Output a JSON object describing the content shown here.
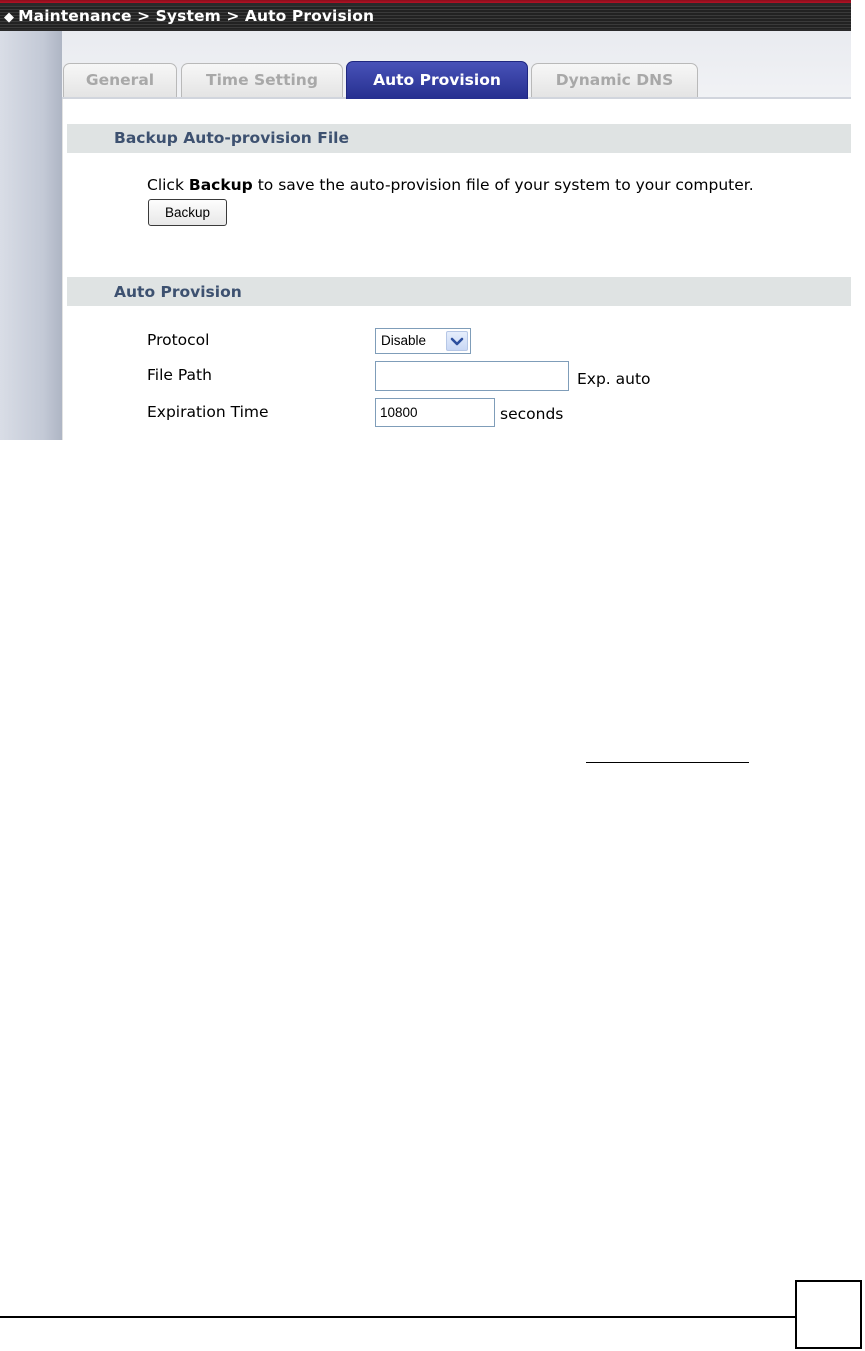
{
  "breadcrumb": "Maintenance > System > Auto Provision",
  "tabs": [
    {
      "label": "General",
      "active": false
    },
    {
      "label": "Time Setting",
      "active": false
    },
    {
      "label": "Auto Provision",
      "active": true
    },
    {
      "label": "Dynamic DNS",
      "active": false
    }
  ],
  "backup_section": {
    "title": "Backup Auto-provision File",
    "instruction_prefix": "Click ",
    "instruction_bold": "Backup",
    "instruction_suffix": " to save the auto-provision file of your system to your computer.",
    "button_label": "Backup"
  },
  "auto_provision_section": {
    "title": "Auto Provision",
    "protocol_label": "Protocol",
    "protocol_value": "Disable",
    "file_path_label": "File Path",
    "file_path_value": "",
    "file_path_hint": "Exp. auto",
    "expiration_label": "Expiration Time",
    "expiration_value": "10800",
    "expiration_unit": "seconds"
  },
  "colors": {
    "active_tab": "#262f8f",
    "section_title": "#3d5170",
    "section_bar": "#dfe3e3",
    "title_bar": "#2a2a2a",
    "title_accent": "#b31226"
  },
  "icons": [
    "diamond-bullet-icon",
    "chevron-down-icon"
  ]
}
